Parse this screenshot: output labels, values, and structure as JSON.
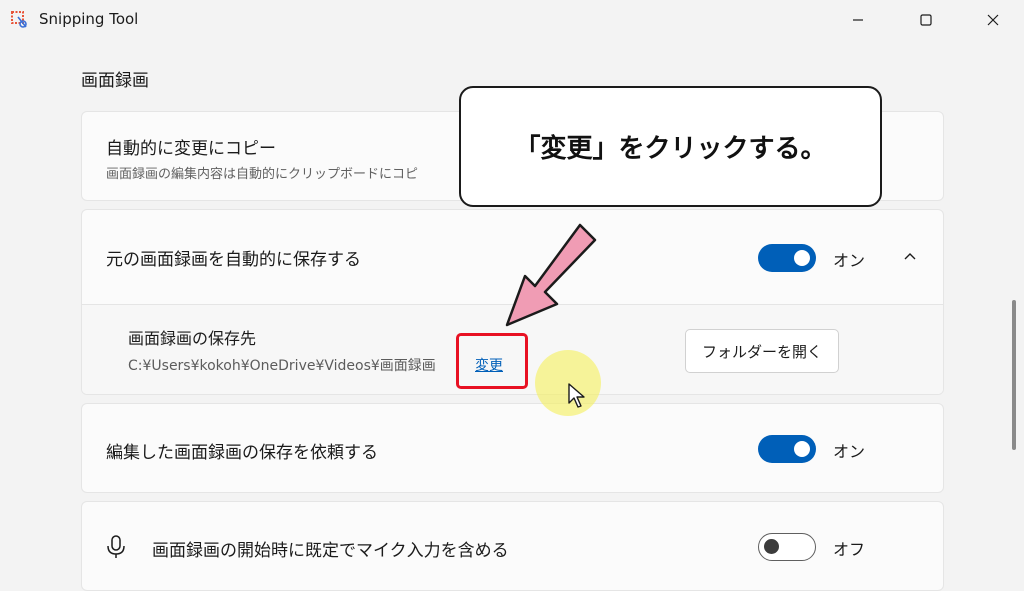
{
  "window": {
    "title": "Snipping Tool"
  },
  "section": {
    "title": "画面録画"
  },
  "settings": {
    "copy_changes": {
      "title": "自動的に変更にコピー",
      "description": "画面録画の編集内容は自動的にクリップボードにコピ"
    },
    "auto_save_original": {
      "title": "元の画面録画を自動的に保存する",
      "toggle_state": "オン",
      "expanded": true,
      "save_location": {
        "label": "画面録画の保存先",
        "path": "C:¥Users¥kokoh¥OneDrive¥Videos¥画面録画",
        "change_link": "変更",
        "open_folder_button": "フォルダーを開く"
      }
    },
    "ask_save_edited": {
      "title": "編集した画面録画の保存を依頼する",
      "toggle_state": "オン"
    },
    "include_mic": {
      "title": "画面録画の開始時に既定でマイク入力を含める",
      "toggle_state": "オフ"
    }
  },
  "annotation": {
    "callout_text": "「変更」をクリックする。",
    "highlight_color": "#e81123",
    "arrow_color": "#f09cb4"
  },
  "colors": {
    "accent": "#005fb8",
    "background": "#f3f3f3",
    "card": "#fbfbfb"
  },
  "icons": [
    "snipping-tool-icon",
    "minimize-icon",
    "maximize-icon",
    "close-icon",
    "chevron-up-icon",
    "microphone-icon",
    "pointer-cursor-icon",
    "pink-arrow-icon"
  ]
}
